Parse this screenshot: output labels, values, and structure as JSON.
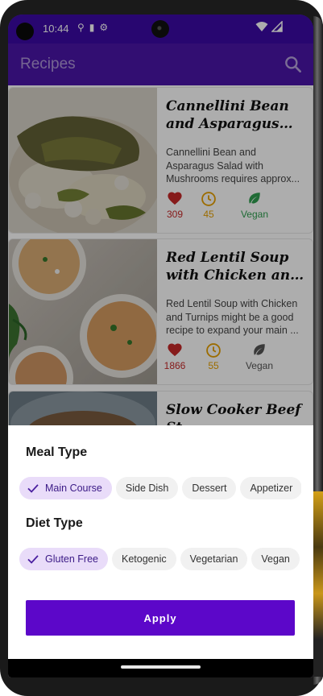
{
  "status_bar": {
    "time": "10:44",
    "icons": [
      "usb-icon",
      "sd-card-icon",
      "settings-icon"
    ],
    "right_icons": [
      "wifi-icon",
      "signal-icon"
    ]
  },
  "app_bar": {
    "title": "Recipes",
    "search_icon": "search-icon"
  },
  "recipes": [
    {
      "title": "Cannellini Bean and Asparagus Salad w...",
      "description": "Cannellini Bean and Asparagus Salad with Mushrooms requires approx...",
      "likes": "309",
      "minutes": "45",
      "diet_label": "Vegan",
      "vegan": true
    },
    {
      "title": "Red Lentil Soup with Chicken and Turnips",
      "description": "Red Lentil Soup with Chicken and Turnips might be a good recipe to expand your main ...",
      "likes": "1866",
      "minutes": "55",
      "diet_label": "Vegan",
      "vegan": false
    },
    {
      "title": "Slow Cooker Beef St...",
      "description": "",
      "likes": "",
      "minutes": "",
      "diet_label": "",
      "vegan": false
    }
  ],
  "filter_sheet": {
    "meal_type": {
      "title": "Meal Type",
      "chips": [
        {
          "label": "Main Course",
          "selected": true
        },
        {
          "label": "Side Dish",
          "selected": false
        },
        {
          "label": "Dessert",
          "selected": false
        },
        {
          "label": "Appetizer",
          "selected": false
        }
      ]
    },
    "diet_type": {
      "title": "Diet Type",
      "chips": [
        {
          "label": "Gluten Free",
          "selected": true
        },
        {
          "label": "Ketogenic",
          "selected": false
        },
        {
          "label": "Vegetarian",
          "selected": false
        },
        {
          "label": "Vegan",
          "selected": false
        }
      ]
    },
    "apply_label": "Apply"
  },
  "colors": {
    "primary": "#5c07c9",
    "status_bar": "#3c0aa6",
    "chip_selected_bg": "#e9dcf9",
    "like_red": "#c62828",
    "time_amber": "#e6a000",
    "vegan_green": "#2e9e4f",
    "vegan_grey": "#555555"
  }
}
